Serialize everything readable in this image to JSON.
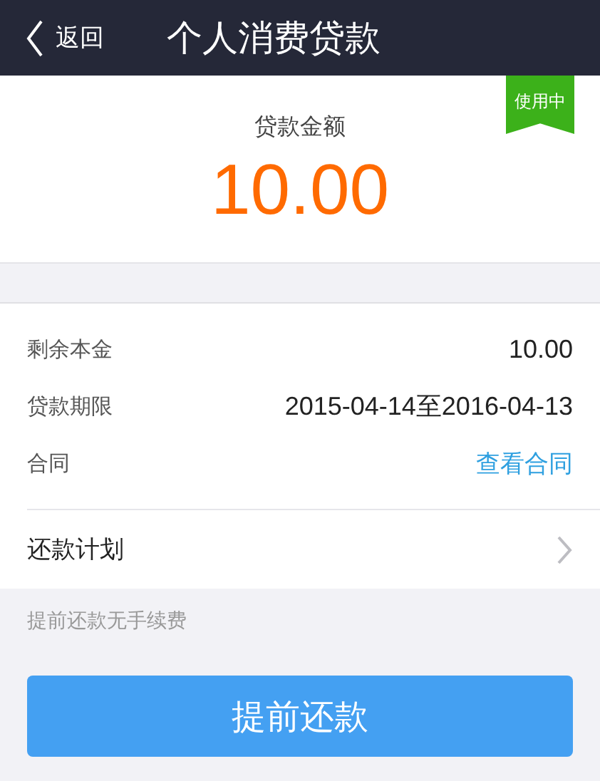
{
  "nav_bar": {
    "back_label": "返回",
    "title": "个人消费贷款"
  },
  "summary": {
    "label": "贷款金额",
    "amount": "10.00",
    "badge": "使用中"
  },
  "details": [
    {
      "kind": "text",
      "label": "剩余本金",
      "value": "10.00"
    },
    {
      "kind": "text",
      "label": "贷款期限",
      "value": "2015-04-14至2016-04-13"
    },
    {
      "kind": "link",
      "label": "合同",
      "value": "查看合同"
    }
  ],
  "plan_row": {
    "label": "还款计划"
  },
  "note": "提前还款无手续费",
  "primary_button": "提前还款"
}
